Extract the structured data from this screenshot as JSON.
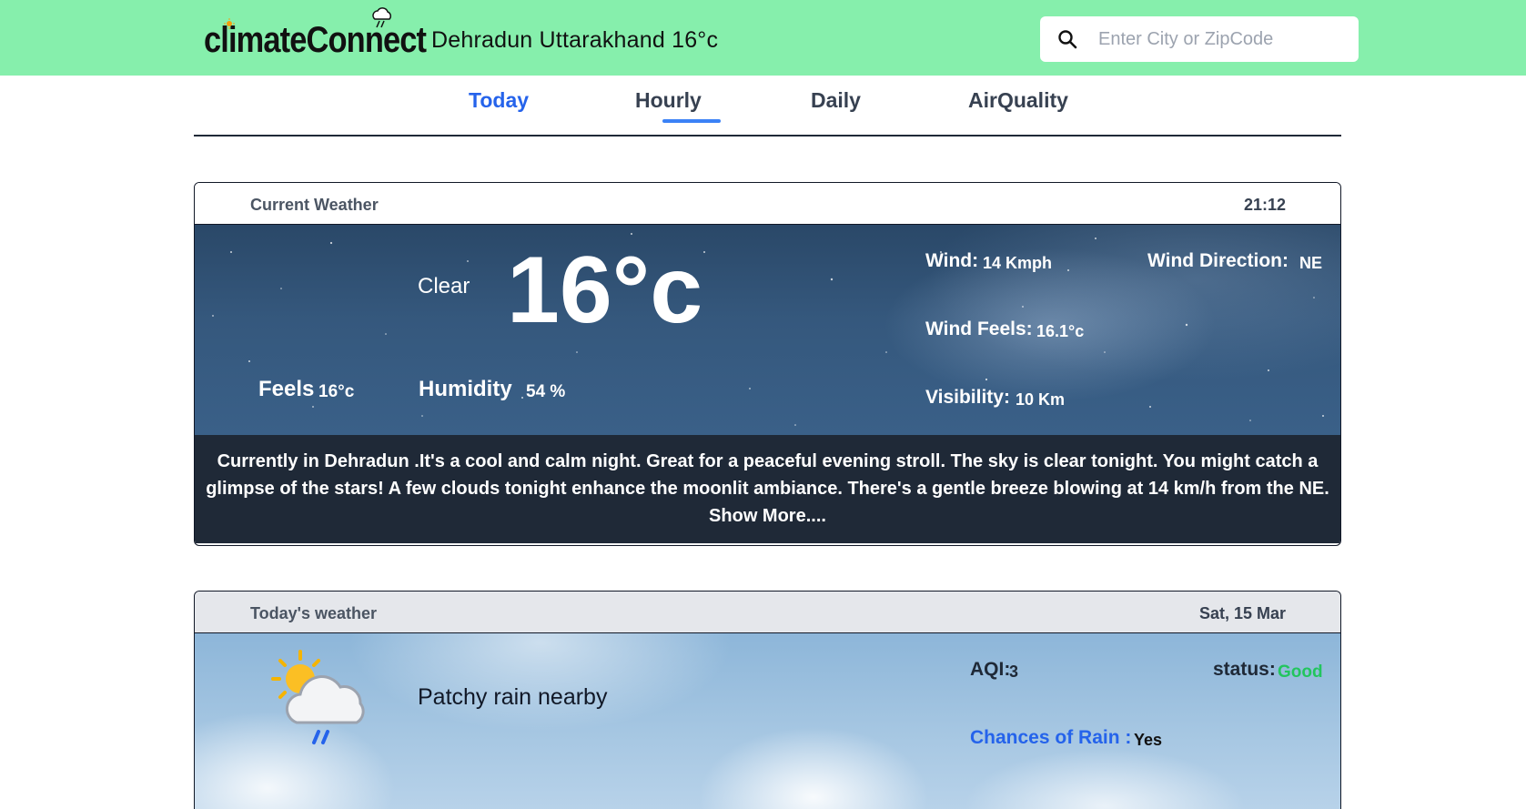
{
  "app": {
    "logo_text": "climateConnect",
    "location": "Dehradun  Uttarakhand 16°c"
  },
  "search": {
    "placeholder": "Enter City or ZipCode",
    "icon": "search-icon"
  },
  "tabs": [
    {
      "label": "Today",
      "active": true
    },
    {
      "label": "Hourly",
      "active": false
    },
    {
      "label": "Daily",
      "active": false
    },
    {
      "label": "AirQuality",
      "active": false
    }
  ],
  "current": {
    "header_label": "Current Weather",
    "time": "21:12",
    "icon": "moon-icon",
    "condition": "Clear",
    "temperature": "16°c",
    "feels_label": "Feels",
    "feels_value": "16°c",
    "humidity_label": "Humidity",
    "humidity_value": "54 %",
    "wind_label": "Wind:",
    "wind_value": "14 Kmph",
    "wind_direction_label": "Wind Direction:",
    "wind_direction_value": "NE",
    "wind_feels_label": "Wind Feels:",
    "wind_feels_value": "16.1°c",
    "visibility_label": "Visibility:",
    "visibility_value": "10 Km",
    "description": "Currently in Dehradun .It's a cool and calm night. Great for a peaceful evening stroll. The sky is clear tonight. You might catch a glimpse of the stars! A few clouds tonight enhance the moonlit ambiance. There's a gentle breeze blowing at 14 km/h from the NE.",
    "show_more": "Show More...."
  },
  "today": {
    "header_label": "Today's weather",
    "date": "Sat, 15 Mar",
    "icon": "partly-cloudy-rain-icon",
    "condition": "Patchy rain nearby",
    "aqi_label": "AQI:",
    "aqi_value": "3",
    "status_label": "status:",
    "status_value": "Good",
    "rain_label": "Chances of Rain :",
    "rain_value": "Yes"
  },
  "colors": {
    "header_bg": "#86efac",
    "accent": "#2563eb",
    "status_good": "#22c55e",
    "description_bg": "#1f2937"
  }
}
